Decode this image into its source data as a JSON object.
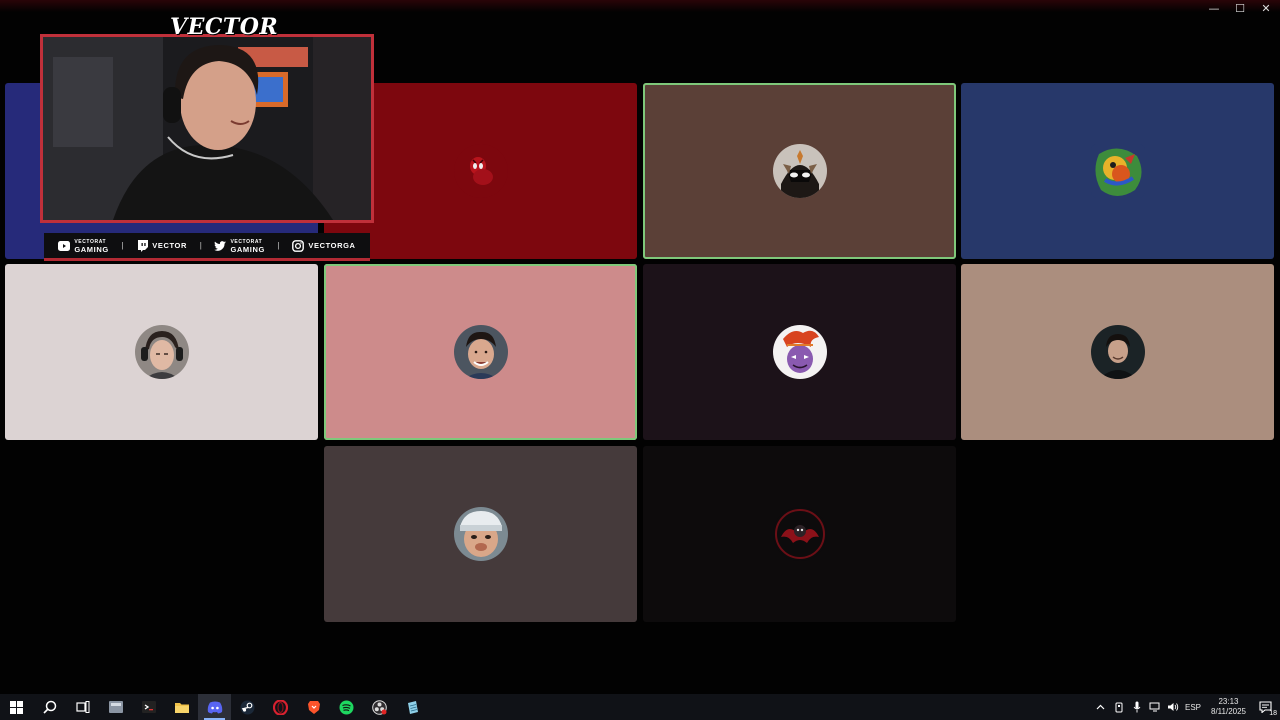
{
  "window": {
    "minimize": "—",
    "maximize": "☐",
    "close": "✕"
  },
  "overlay": {
    "logo": "VECTOR",
    "socials": [
      {
        "icon": "youtube-icon",
        "line1": "VECTORAT",
        "line2": "GAMING"
      },
      {
        "icon": "twitch-icon",
        "line1": "VECTOR",
        "line2": ""
      },
      {
        "icon": "twitter-icon",
        "line1": "VECTORAT",
        "line2": "GAMING"
      },
      {
        "icon": "instagram-icon",
        "line1": "VECTORGA",
        "line2": ""
      }
    ]
  },
  "participants": [
    {
      "color": "#262a7a",
      "speaking": false,
      "avatar": "hidden"
    },
    {
      "color": "#7d070e",
      "speaking": false,
      "avatar": "spider-avatar"
    },
    {
      "color": "#5b4037",
      "speaking": true,
      "avatar": "masked-hero-avatar"
    },
    {
      "color": "#27386a",
      "speaking": false,
      "avatar": "colorful-art-avatar"
    },
    {
      "color": "#dcd3d3",
      "speaking": false,
      "avatar": "headphones-person-avatar"
    },
    {
      "color": "#cd8b8b",
      "speaking": true,
      "avatar": "smiling-man-avatar"
    },
    {
      "color": "#1c1219",
      "speaking": false,
      "avatar": "cartoon-character-avatar"
    },
    {
      "color": "#ab8e7e",
      "speaking": false,
      "avatar": "dark-hair-man-avatar"
    },
    {
      "color": "#453a3b",
      "speaking": false,
      "avatar": "cap-person-avatar"
    },
    {
      "color": "#0d0b0c",
      "speaking": false,
      "avatar": "red-emblem-avatar"
    }
  ],
  "taskbar": {
    "apps": [
      "windows-start-icon",
      "search-icon",
      "task-view-icon",
      "file-app-icon",
      "terminal-app-icon",
      "file-explorer-icon",
      "discord-icon",
      "steam-icon",
      "opera-icon",
      "brave-icon",
      "spotify-icon",
      "obs-icon",
      "notepad-icon"
    ],
    "active_app": "discord-icon",
    "language": "ESP",
    "time": "23:13",
    "date": "8/11/2025",
    "notification_count": "18"
  }
}
